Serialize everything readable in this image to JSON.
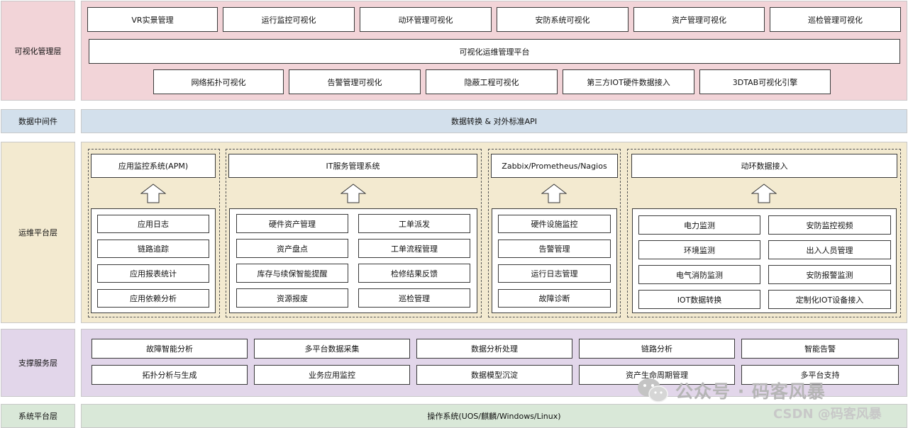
{
  "colors": {
    "visual": "#f2d4d8",
    "middleware": "#d3e0ec",
    "ops": "#f3ead0",
    "support": "#e2d6ea",
    "system": "#d9e8d8"
  },
  "layers": {
    "visual": "可视化管理层",
    "middleware": "数据中间件",
    "ops": "运维平台层",
    "support": "支撑服务层",
    "system": "系统平台层"
  },
  "visual": {
    "row1": [
      "VR实景管理",
      "运行监控可视化",
      "动环管理可视化",
      "安防系统可视化",
      "资产管理可视化",
      "巡检管理可视化"
    ],
    "platform": "可视化运维管理平台",
    "row3": [
      "网络拓扑可视化",
      "告警管理可视化",
      "隐蔽工程可视化",
      "第三方IOT硬件数据接入",
      "3DTAB可视化引擎"
    ]
  },
  "middleware": {
    "api": "数据转换 & 对外标准API"
  },
  "ops": {
    "apm": {
      "title": "应用监控系统(APM)",
      "items": [
        "应用日志",
        "链路追踪",
        "应用报表统计",
        "应用依赖分析"
      ]
    },
    "itsm": {
      "title": "IT服务管理系统",
      "left": [
        "硬件资产管理",
        "资产盘点",
        "库存与续保智能提醒",
        "资源报废"
      ],
      "right": [
        "工单派发",
        "工单流程管理",
        "检修结果反馈",
        "巡检管理"
      ]
    },
    "zabbix": {
      "title": "Zabbix/Prometheus/Nagios",
      "items": [
        "硬件设施监控",
        "告警管理",
        "运行日志管理",
        "故障诊断"
      ]
    },
    "env": {
      "title": "动环数据接入",
      "left": [
        "电力监测",
        "环境监测",
        "电气消防监测",
        "IOT数据转换"
      ],
      "right": [
        "安防监控视频",
        "出入人员管理",
        "安防报警监测",
        "定制化IOT设备接入"
      ]
    }
  },
  "support": {
    "row1": [
      "故障智能分析",
      "多平台数据采集",
      "数据分析处理",
      "链路分析",
      "智能告警"
    ],
    "row2": [
      "拓扑分析与生成",
      "业务应用监控",
      "数据模型沉淀",
      "资产生命周期管理",
      "多平台支持"
    ]
  },
  "system": {
    "os": "操作系统(UOS/麒麟/Windows/Linux)"
  },
  "watermark": {
    "line1": "公众号 · 码客风暴",
    "line2": "CSDN @码客风暴"
  }
}
